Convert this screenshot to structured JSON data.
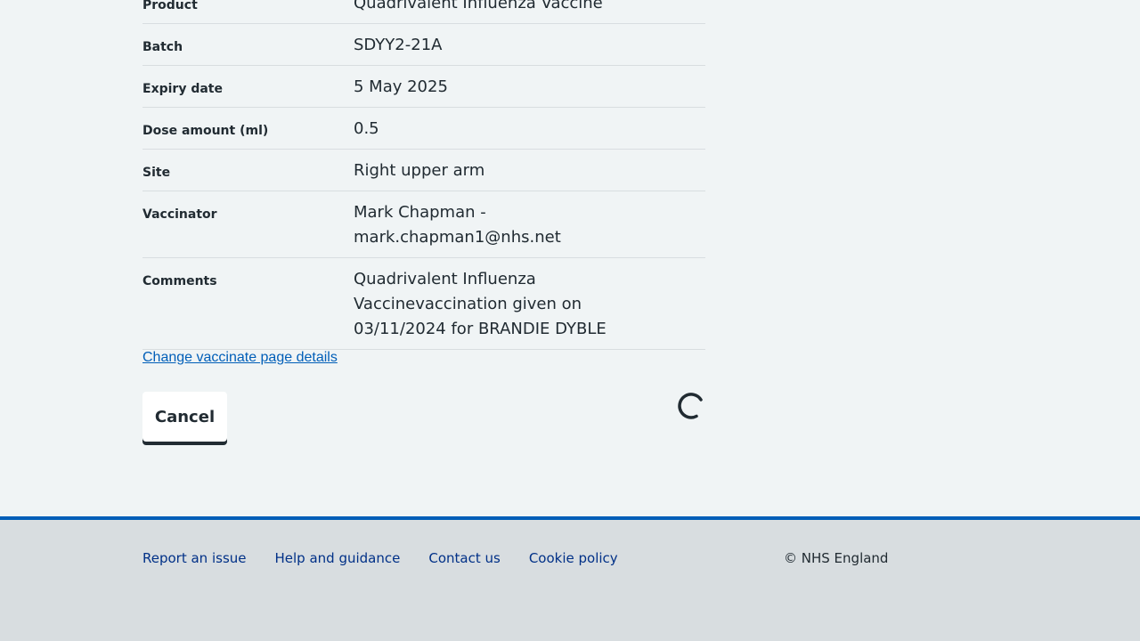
{
  "summary": {
    "rows": [
      {
        "key": "Product",
        "value": "Quadrivalent Influenza Vaccine"
      },
      {
        "key": "Batch",
        "value": "SDYY2-21A"
      },
      {
        "key": "Expiry date",
        "value": "5 May 2025"
      },
      {
        "key": "Dose amount (ml)",
        "value": "0.5"
      },
      {
        "key": "Site",
        "value": "Right upper arm"
      },
      {
        "key": "Vaccinator",
        "value": "Mark Chapman - mark.chapman1@nhs.net"
      },
      {
        "key": "Comments",
        "value": "Quadrivalent Influenza Vaccinevaccination given on 03/11/2024 for BRANDIE DYBLE"
      }
    ]
  },
  "actions": {
    "change_link": "Change vaccinate page details",
    "cancel_label": "Cancel",
    "loading_icon": "spinner-icon"
  },
  "footer": {
    "links": [
      "Report an issue",
      "Help and guidance",
      "Contact us",
      "Cookie policy"
    ],
    "copyright": "© NHS England"
  },
  "colors": {
    "page_bg": "#f0f4f5",
    "text": "#212b32",
    "link": "#005eb8",
    "footer_link": "#003087",
    "footer_bg": "#d8dde0",
    "footer_border": "#005eb8"
  }
}
